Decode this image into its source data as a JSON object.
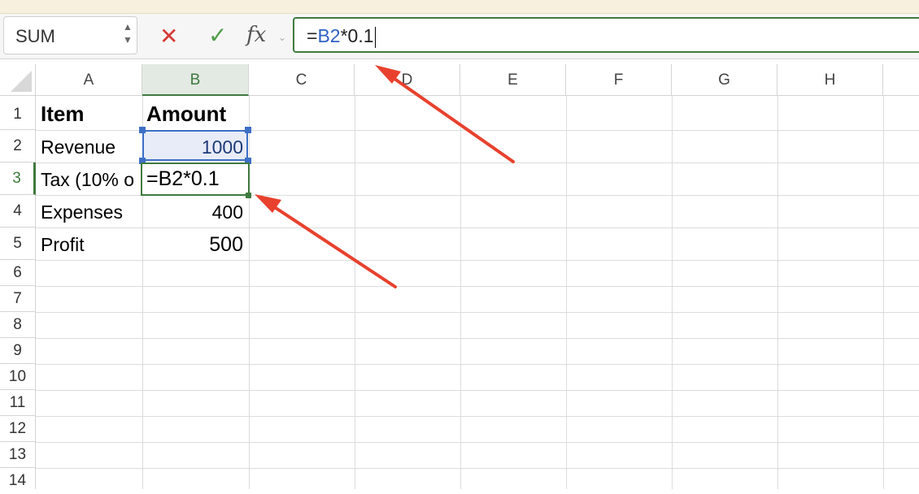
{
  "formula_bar": {
    "name_box": "SUM",
    "formula_prefix": "=",
    "formula_ref": "B2",
    "formula_suffix": "*0.1",
    "cancel_icon": "x-icon",
    "confirm_icon": "check-icon",
    "fx_label": "fx"
  },
  "columns": [
    "A",
    "B",
    "C",
    "D",
    "E",
    "F",
    "G",
    "H"
  ],
  "rows": [
    "1",
    "2",
    "3",
    "4",
    "5",
    "6",
    "7",
    "8",
    "9",
    "10",
    "11",
    "12",
    "13",
    "14"
  ],
  "cells": {
    "A1": "Item",
    "B1": "Amount",
    "A2": "Revenue",
    "B2": "1000",
    "A3": "Tax (10% o",
    "B3": "=B2*0.1",
    "A4": "Expenses",
    "B4": "400",
    "A5": "Profit",
    "B5": "500"
  },
  "colors": {
    "accent_green": "#3e7a3f",
    "ref_blue": "#3d6fc6",
    "annotation_red": "#e8412e"
  }
}
